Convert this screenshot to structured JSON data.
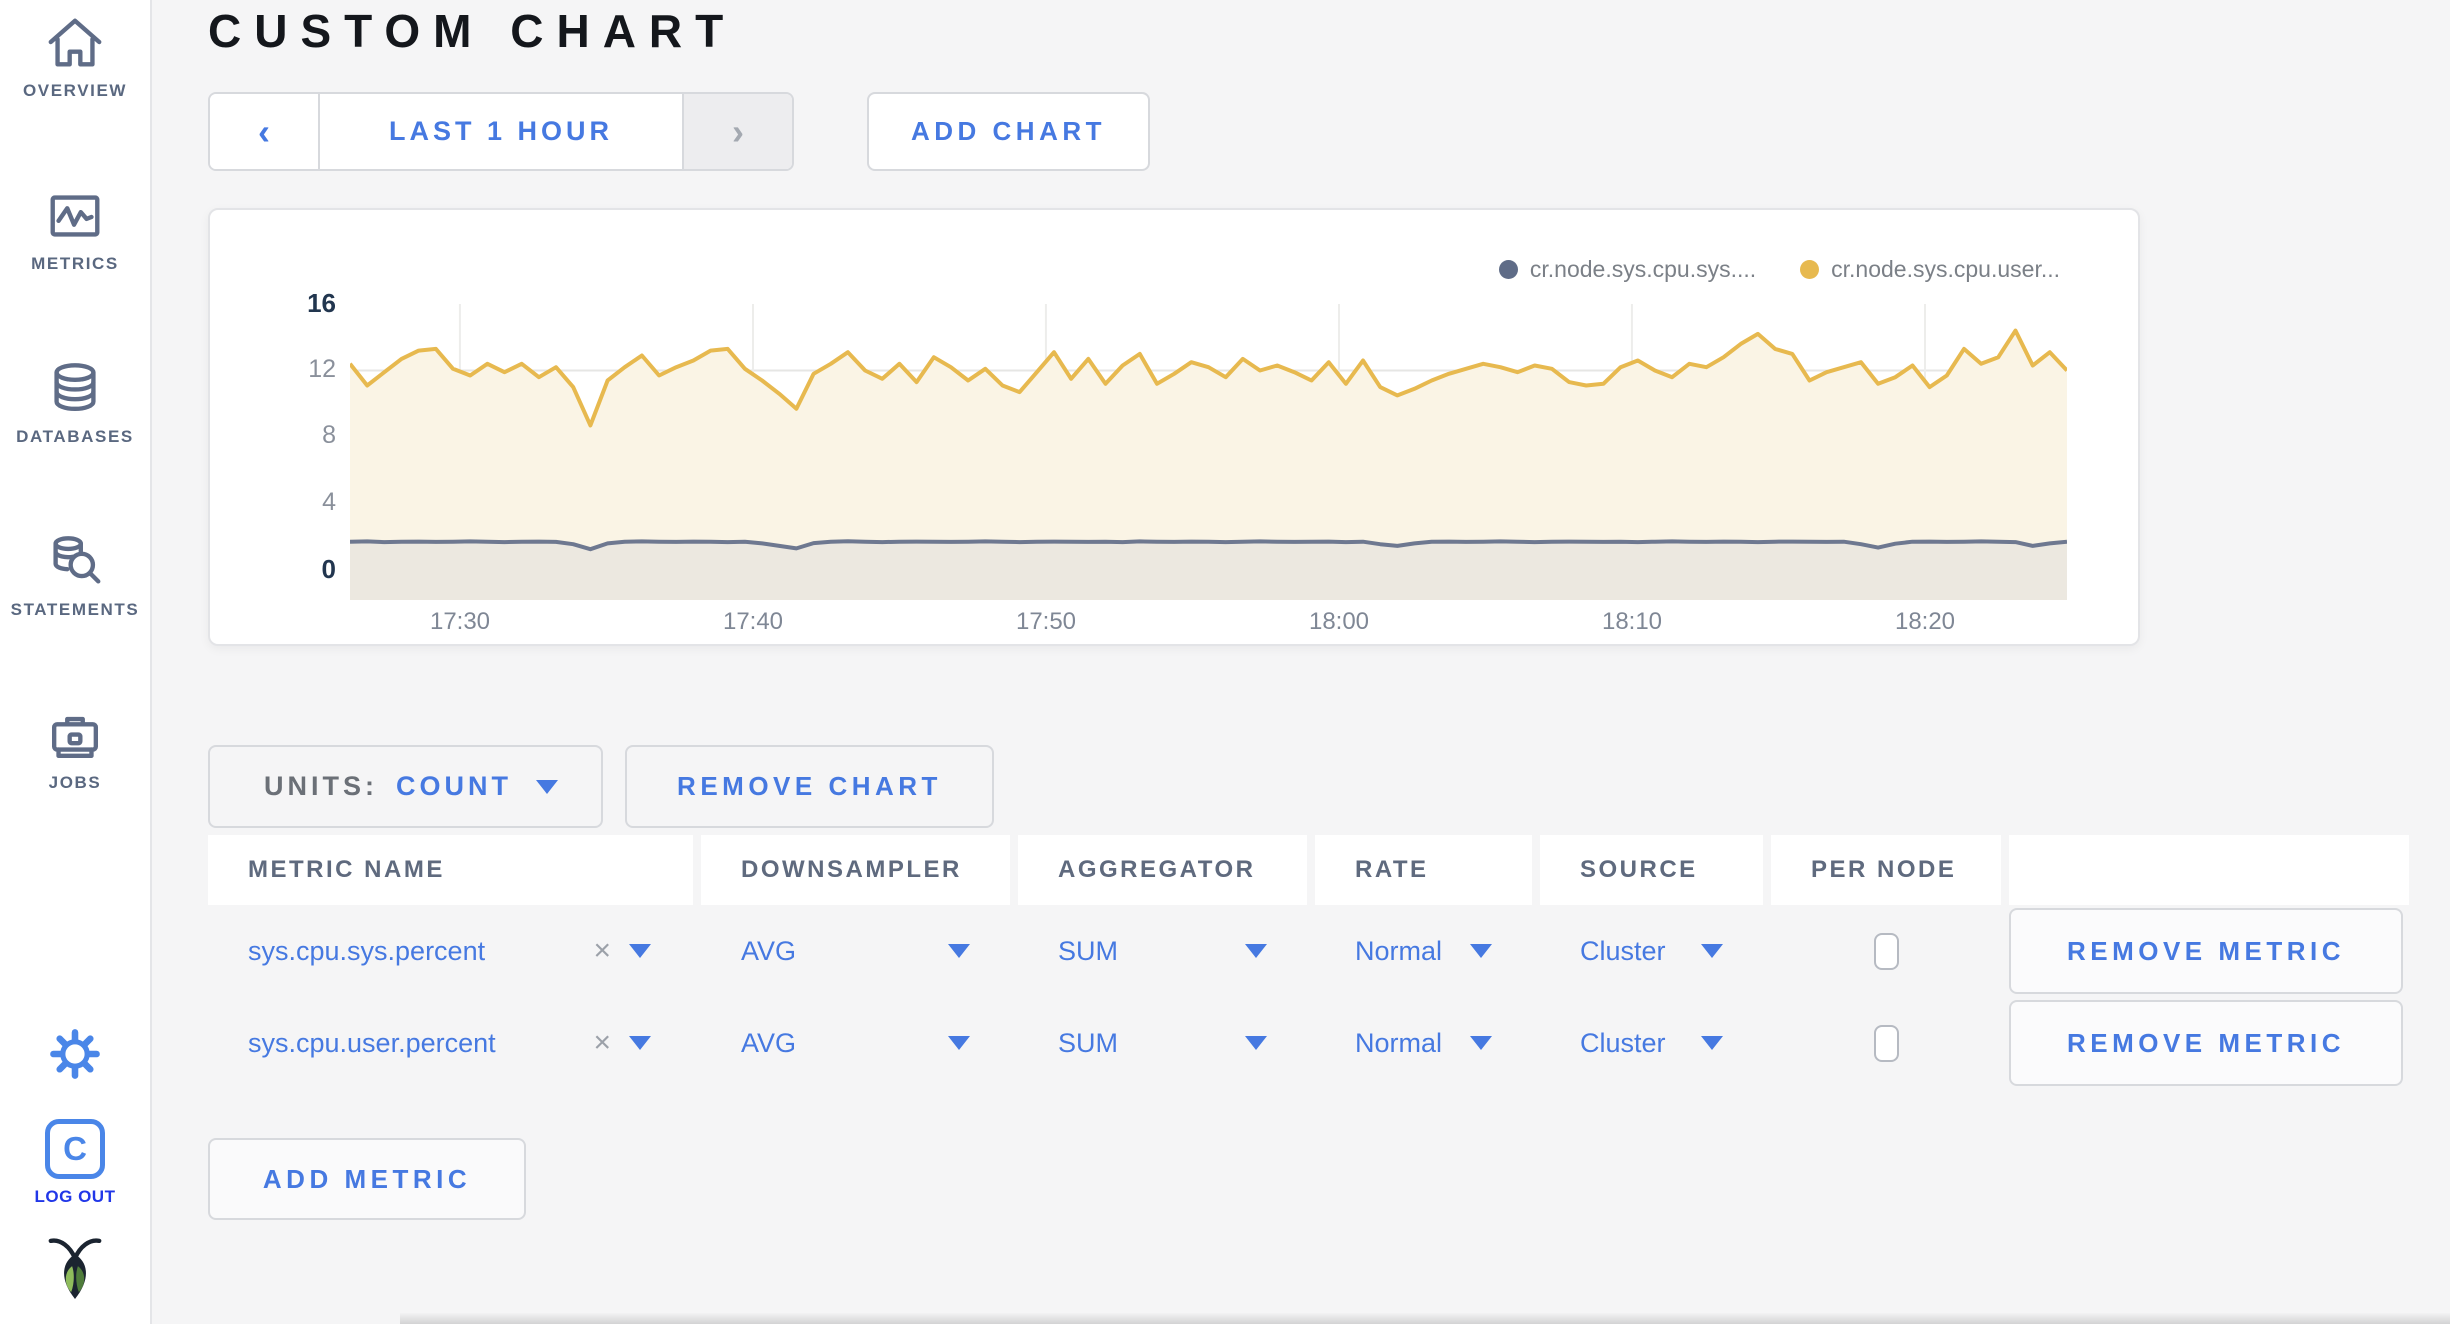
{
  "sidebar": {
    "items": [
      {
        "label": "OVERVIEW",
        "icon": "home-icon"
      },
      {
        "label": "METRICS",
        "icon": "metrics-icon"
      },
      {
        "label": "DATABASES",
        "icon": "database-icon"
      },
      {
        "label": "STATEMENTS",
        "icon": "statements-icon"
      },
      {
        "label": "JOBS",
        "icon": "jobs-icon"
      }
    ],
    "logout_letter": "C",
    "logout_label": "LOG OUT"
  },
  "header": {
    "title": "CUSTOM CHART"
  },
  "toolbar": {
    "prev": "‹",
    "time_range": "LAST 1 HOUR",
    "next": "›",
    "add_chart": "ADD CHART"
  },
  "units": {
    "label": "UNITS:",
    "value": "COUNT"
  },
  "buttons": {
    "remove_chart": "REMOVE CHART",
    "remove_metric": "REMOVE METRIC",
    "add_metric": "ADD METRIC"
  },
  "table": {
    "headers": [
      "METRIC NAME",
      "DOWNSAMPLER",
      "AGGREGATOR",
      "RATE",
      "SOURCE",
      "PER NODE",
      ""
    ],
    "rows": [
      {
        "metric_name": "sys.cpu.sys.percent",
        "clear": "×",
        "downsampler": "AVG",
        "aggregator": "SUM",
        "rate": "Normal",
        "source": "Cluster",
        "per_node_checked": false
      },
      {
        "metric_name": "sys.cpu.user.percent",
        "clear": "×",
        "downsampler": "AVG",
        "aggregator": "SUM",
        "rate": "Normal",
        "source": "Cluster",
        "per_node_checked": false
      }
    ]
  },
  "chart_data": {
    "type": "line",
    "title": "",
    "xlabel": "",
    "ylabel": "",
    "ylim": [
      0,
      16
    ],
    "grid": true,
    "legend_position": "top-right",
    "grid_color": "#E6E6E4",
    "xticks": [
      "17:30",
      "17:40",
      "17:50",
      "18:00",
      "18:10",
      "18:20"
    ],
    "xtick_fracs": [
      0.064,
      0.2347,
      0.4053,
      0.576,
      0.7466,
      0.9173
    ],
    "yticks": [
      {
        "label": "0",
        "value": 0,
        "emph": true
      },
      {
        "label": "4",
        "value": 4,
        "emph": false
      },
      {
        "label": "8",
        "value": 8,
        "emph": false
      },
      {
        "label": "12",
        "value": 12,
        "emph": false
      },
      {
        "label": "16",
        "value": 16,
        "emph": true
      }
    ],
    "series": [
      {
        "name": "cr.node.sys.cpu.sys.percent",
        "legend_label": "cr.node.sys.cpu.sys....",
        "color": "#5F6C87",
        "line_color": "#6E7890",
        "fill": "#ECE8E0",
        "values": [
          1.7,
          1.72,
          1.68,
          1.7,
          1.71,
          1.69,
          1.7,
          1.72,
          1.7,
          1.68,
          1.7,
          1.71,
          1.69,
          1.55,
          1.25,
          1.6,
          1.7,
          1.72,
          1.7,
          1.69,
          1.71,
          1.7,
          1.68,
          1.7,
          1.6,
          1.45,
          1.3,
          1.62,
          1.7,
          1.73,
          1.7,
          1.68,
          1.7,
          1.71,
          1.7,
          1.69,
          1.7,
          1.72,
          1.7,
          1.68,
          1.7,
          1.71,
          1.7,
          1.69,
          1.7,
          1.68,
          1.72,
          1.7,
          1.69,
          1.71,
          1.7,
          1.68,
          1.7,
          1.72,
          1.7,
          1.69,
          1.7,
          1.71,
          1.68,
          1.7,
          1.55,
          1.45,
          1.6,
          1.7,
          1.71,
          1.69,
          1.7,
          1.72,
          1.7,
          1.68,
          1.7,
          1.71,
          1.7,
          1.69,
          1.7,
          1.68,
          1.7,
          1.72,
          1.7,
          1.69,
          1.71,
          1.7,
          1.68,
          1.7,
          1.71,
          1.7,
          1.69,
          1.7,
          1.55,
          1.35,
          1.58,
          1.7,
          1.71,
          1.69,
          1.7,
          1.72,
          1.7,
          1.68,
          1.45,
          1.6,
          1.7
        ]
      },
      {
        "name": "cr.node.sys.cpu.user.percent",
        "legend_label": "cr.node.sys.cpu.user...",
        "color": "#E7B94F",
        "line_color": "#E7B94F",
        "fill": "#FAF4E5",
        "values": [
          12.4,
          11.1,
          11.9,
          12.7,
          13.2,
          13.3,
          12.1,
          11.7,
          12.4,
          11.9,
          12.4,
          11.6,
          12.2,
          11.0,
          8.7,
          11.4,
          12.2,
          12.9,
          11.7,
          12.2,
          12.6,
          13.2,
          13.3,
          12.1,
          11.4,
          10.6,
          9.7,
          11.8,
          12.4,
          13.1,
          12.0,
          11.5,
          12.4,
          11.3,
          12.8,
          12.2,
          11.4,
          12.1,
          11.1,
          10.7,
          11.9,
          13.1,
          11.5,
          12.7,
          11.2,
          12.3,
          13.0,
          11.2,
          11.8,
          12.5,
          12.2,
          11.6,
          12.7,
          12.0,
          12.3,
          11.9,
          11.4,
          12.5,
          11.2,
          12.6,
          11.0,
          10.5,
          10.9,
          11.4,
          11.8,
          12.1,
          12.4,
          12.2,
          11.9,
          12.3,
          12.1,
          11.3,
          11.1,
          11.2,
          12.2,
          12.6,
          12.0,
          11.6,
          12.4,
          12.2,
          12.8,
          13.6,
          14.2,
          13.3,
          13.0,
          11.4,
          11.9,
          12.2,
          12.5,
          11.2,
          11.6,
          12.3,
          11.0,
          11.7,
          13.3,
          12.4,
          12.8,
          14.4,
          12.3,
          13.1,
          12.0
        ]
      }
    ]
  },
  "colors": {
    "accent_blue": "#4679E1",
    "logout_blue": "#2137E8",
    "slate": "#5F6C87",
    "page_bg": "#F5F5F6",
    "yellow_series": "#E7B94F",
    "gray_series": "#6E7890"
  }
}
